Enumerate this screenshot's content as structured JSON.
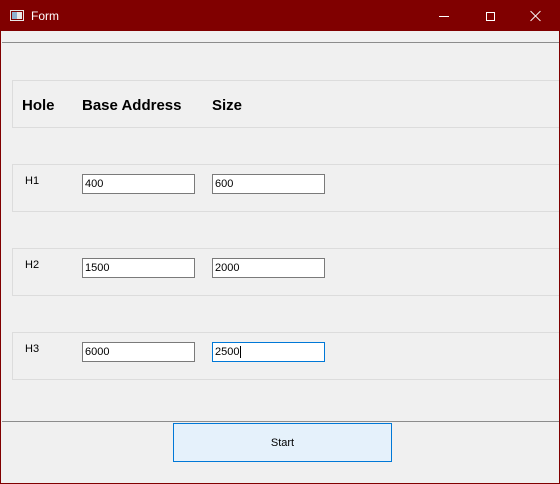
{
  "window": {
    "title": "Form",
    "title_bar_color": "#800000",
    "icon": "app-window-icon",
    "controls": {
      "minimize": "minimize-icon",
      "maximize": "maximize-icon",
      "close": "close-icon"
    }
  },
  "table": {
    "headers": {
      "hole": "Hole",
      "base": "Base Address",
      "size": "Size"
    },
    "rows": [
      {
        "hole": "H1",
        "base": "400",
        "size": "600"
      },
      {
        "hole": "H2",
        "base": "1500",
        "size": "2000"
      },
      {
        "hole": "H3",
        "base": "6000",
        "size": "2500"
      }
    ]
  },
  "actions": {
    "start_label": "Start",
    "accent_color": "#0078d7"
  }
}
